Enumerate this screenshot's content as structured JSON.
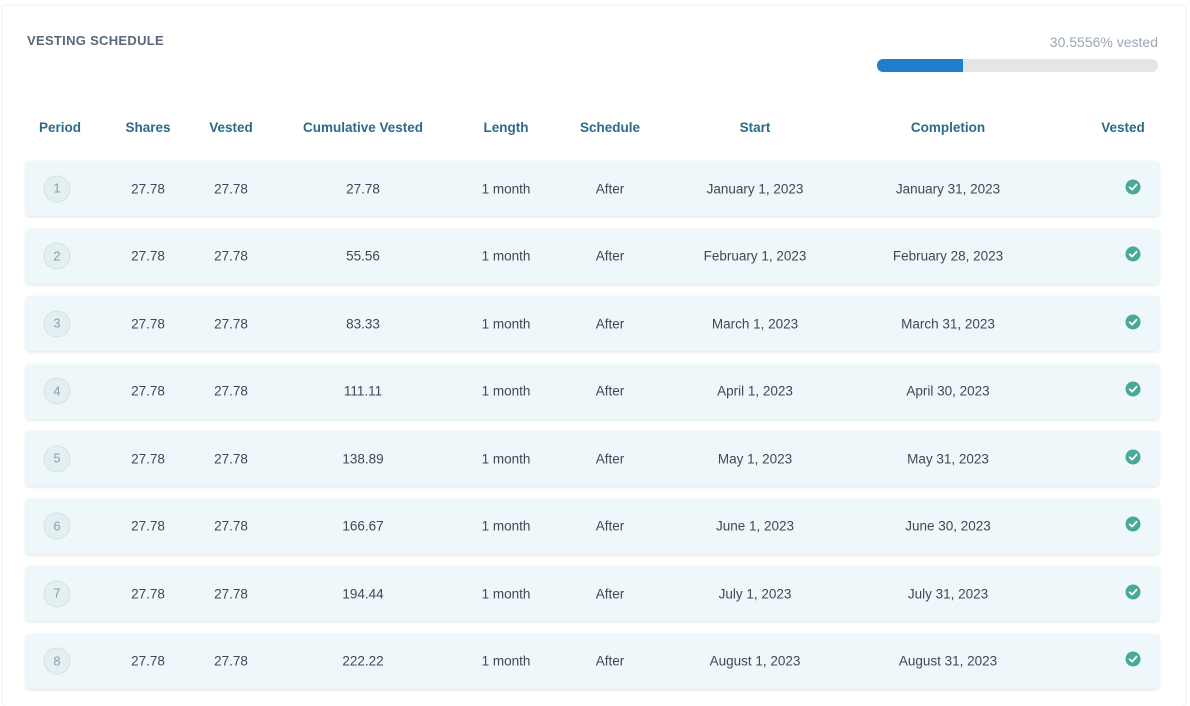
{
  "header": {
    "title": "VESTING SCHEDULE",
    "progress_label": "30.5556% vested",
    "progress_fraction": 0.305556
  },
  "colors": {
    "accent": "#1e7ecc",
    "check": "#48a999",
    "header_text": "#2b6a88"
  },
  "table": {
    "columns": [
      "Period",
      "Shares",
      "Vested",
      "Cumulative Vested",
      "Length",
      "Schedule",
      "Start",
      "Completion",
      "Vested"
    ],
    "rows": [
      {
        "period": "1",
        "shares": "27.78",
        "vested": "27.78",
        "cumulative": "27.78",
        "length": "1 month",
        "schedule": "After",
        "start": "January 1, 2023",
        "completion": "January 31, 2023",
        "status_icon": "check-circle-icon"
      },
      {
        "period": "2",
        "shares": "27.78",
        "vested": "27.78",
        "cumulative": "55.56",
        "length": "1 month",
        "schedule": "After",
        "start": "February 1, 2023",
        "completion": "February 28, 2023",
        "status_icon": "check-circle-icon"
      },
      {
        "period": "3",
        "shares": "27.78",
        "vested": "27.78",
        "cumulative": "83.33",
        "length": "1 month",
        "schedule": "After",
        "start": "March 1, 2023",
        "completion": "March 31, 2023",
        "status_icon": "check-circle-icon"
      },
      {
        "period": "4",
        "shares": "27.78",
        "vested": "27.78",
        "cumulative": "111.11",
        "length": "1 month",
        "schedule": "After",
        "start": "April 1, 2023",
        "completion": "April 30, 2023",
        "status_icon": "check-circle-icon"
      },
      {
        "period": "5",
        "shares": "27.78",
        "vested": "27.78",
        "cumulative": "138.89",
        "length": "1 month",
        "schedule": "After",
        "start": "May 1, 2023",
        "completion": "May 31, 2023",
        "status_icon": "check-circle-icon"
      },
      {
        "period": "6",
        "shares": "27.78",
        "vested": "27.78",
        "cumulative": "166.67",
        "length": "1 month",
        "schedule": "After",
        "start": "June 1, 2023",
        "completion": "June 30, 2023",
        "status_icon": "check-circle-icon"
      },
      {
        "period": "7",
        "shares": "27.78",
        "vested": "27.78",
        "cumulative": "194.44",
        "length": "1 month",
        "schedule": "After",
        "start": "July 1, 2023",
        "completion": "July 31, 2023",
        "status_icon": "check-circle-icon"
      },
      {
        "period": "8",
        "shares": "27.78",
        "vested": "27.78",
        "cumulative": "222.22",
        "length": "1 month",
        "schedule": "After",
        "start": "August 1, 2023",
        "completion": "August 31, 2023",
        "status_icon": "check-circle-icon"
      }
    ]
  }
}
